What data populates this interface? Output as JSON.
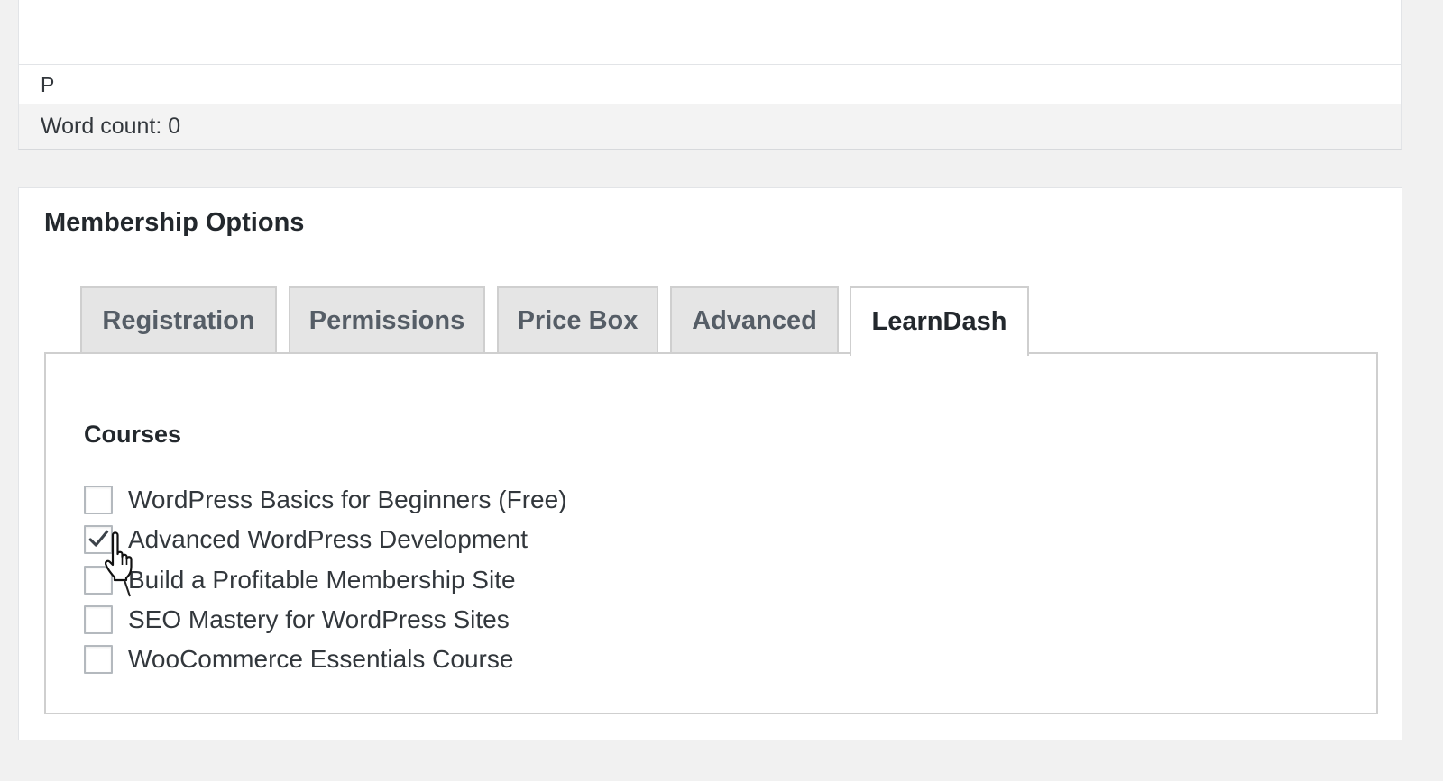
{
  "editor": {
    "path_label": "P",
    "word_count": "Word count: 0"
  },
  "membership": {
    "title": "Membership Options",
    "tabs": [
      {
        "label": "Registration",
        "active": false
      },
      {
        "label": "Permissions",
        "active": false
      },
      {
        "label": "Price Box",
        "active": false
      },
      {
        "label": "Advanced",
        "active": false
      },
      {
        "label": "LearnDash",
        "active": true
      }
    ],
    "learndash": {
      "section_title": "Courses",
      "courses": [
        {
          "label": "WordPress Basics for Beginners (Free)",
          "checked": false
        },
        {
          "label": "Advanced WordPress Development",
          "checked": true
        },
        {
          "label": "Build a Profitable Membership Site",
          "checked": false
        },
        {
          "label": "SEO Mastery for WordPress Sites",
          "checked": false
        },
        {
          "label": "WooCommerce Essentials Course",
          "checked": false
        }
      ]
    }
  },
  "icons": {
    "checkmark": "checkmark-icon",
    "cursor": "hand-pointer-cursor-icon"
  },
  "colors": {
    "page_background": "#f1f1f1",
    "tab_inactive": "#e5e5e5",
    "border": "#cfcfcf",
    "text": "#23282d",
    "checkbox_border": "#b4b9be"
  }
}
